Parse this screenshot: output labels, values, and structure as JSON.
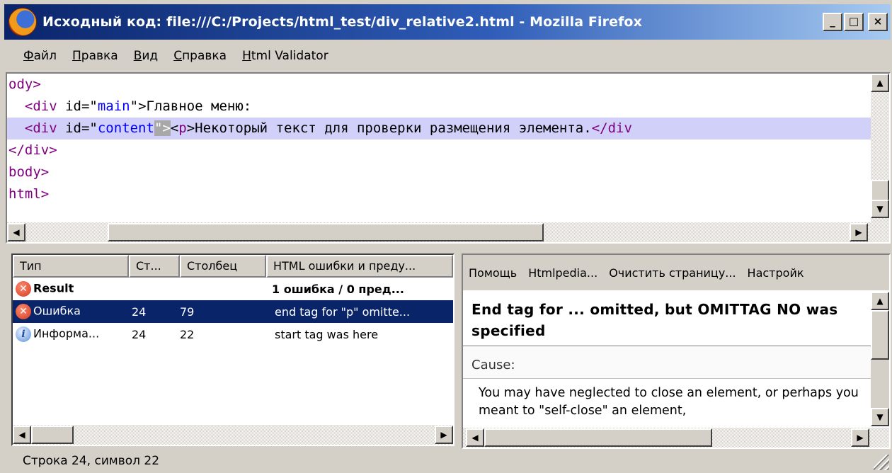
{
  "window": {
    "title": "Исходный код: file:///C:/Projects/html_test/div_relative2.html - Mozilla Firefox",
    "buttons": {
      "minimize": "_",
      "maximize": "□",
      "close": "×"
    }
  },
  "menu": [
    {
      "label": "Файл",
      "accel": "Ф",
      "rest": "айл"
    },
    {
      "label": "Правка",
      "accel": "П",
      "rest": "равка"
    },
    {
      "label": "Вид",
      "accel": "В",
      "rest": "ид"
    },
    {
      "label": "Справка",
      "accel": "С",
      "rest": "правка"
    },
    {
      "label": "Html Validator",
      "accel": "H",
      "rest": "tml Validator"
    }
  ],
  "source": {
    "lines": [
      "ody>",
      "  <div id=\"main\">Главное меню:",
      "  <div id=\"content\"><p>Некоторый текст для проверки размещения элемента.</div",
      "</div>",
      "body>",
      "html>"
    ]
  },
  "errors": {
    "columns": [
      "Тип",
      "Ст...",
      "Столбец",
      "HTML ошибки и преду..."
    ],
    "result": {
      "label": "Result",
      "summary": "1 ошибка / 0 пред..."
    },
    "rows": [
      {
        "icon": "error-icon",
        "type": "Ошибка",
        "line": "24",
        "col": "79",
        "message": "end tag for \"p\" omitte..."
      },
      {
        "icon": "info-icon",
        "type": "Информа...",
        "line": "24",
        "col": "22",
        "message": "start tag was here"
      }
    ]
  },
  "help": {
    "toolbar": [
      "Помощь",
      "Htmlpedia...",
      "Очистить страницу...",
      "Настройк"
    ],
    "title": "End tag for ... omitted, but OMITTAG NO was specified",
    "cause_label": "Cause:",
    "body": "You may have neglected to close an element, or perhaps you meant to \"self-close\" an element,"
  },
  "status": {
    "text": "Строка 24, символ 22"
  }
}
